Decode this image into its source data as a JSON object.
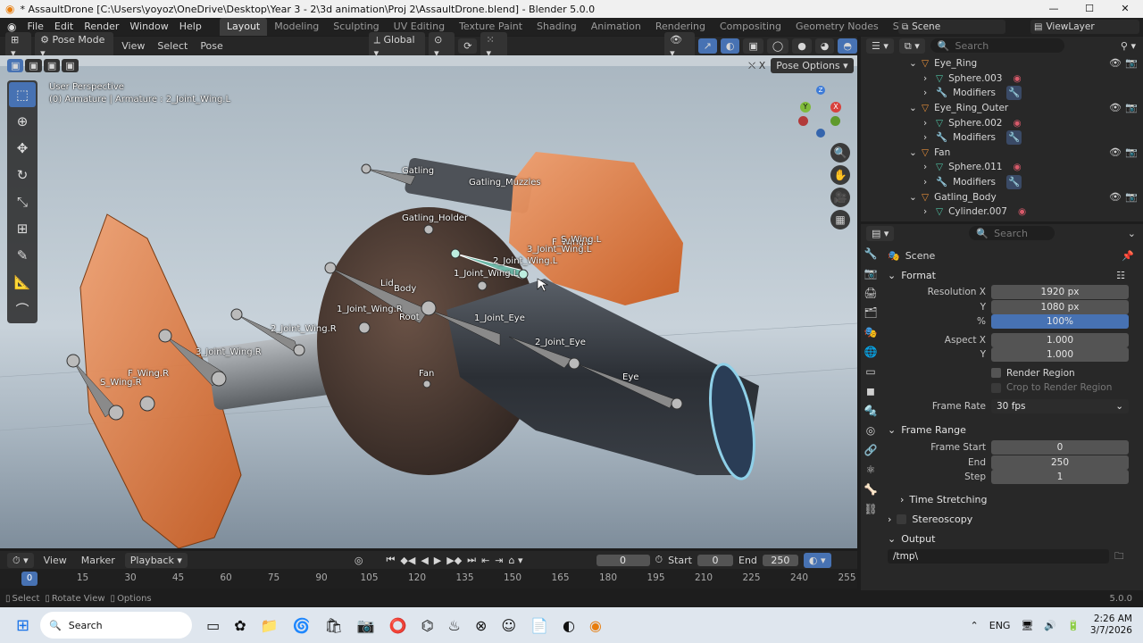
{
  "titlebar": {
    "title": "* AssaultDrone [C:\\Users\\yoyoz\\OneDrive\\Desktop\\Year 3 - 2\\3d animation\\Proj 2\\AssaultDrone.blend] - Blender 5.0.0",
    "minimize": "—",
    "maximize": "☐",
    "close": "✕"
  },
  "menu": {
    "items": [
      "File",
      "Edit",
      "Render",
      "Window",
      "Help"
    ],
    "workspaces": [
      "Layout",
      "Modeling",
      "Sculpting",
      "UV Editing",
      "Texture Paint",
      "Shading",
      "Animation",
      "Rendering",
      "Compositing",
      "Geometry Nodes",
      "Scripting"
    ],
    "add": "+",
    "scene": "Scene",
    "view_layer": "ViewLayer"
  },
  "viewport_header": {
    "mode": "Pose Mode",
    "view": "View",
    "select": "Select",
    "pose": "Pose",
    "orientation": "Global",
    "pose_options": "Pose Options"
  },
  "viewport": {
    "perspective": "User Perspective",
    "context": "(0) Armature | Armature : 2_Joint_Wing.L",
    "axis_x": "X",
    "axis_y": "Y",
    "axis_z": "Z",
    "bones": [
      "Gatling",
      "Gatling_Muzzles",
      "Gatling_Holder",
      "3_Joint_Wing.L",
      "F_Wing.L",
      "S_Wing.L",
      "2_Joint_Wing.L",
      "1_Joint_Wing.L",
      "Lid",
      "Body",
      "1_Joint_Wing.R",
      "Root",
      "2_Joint_Wing.R",
      "3_Joint_Wing.R",
      "F_Wing.R",
      "S_Wing.R",
      "1_Joint_Eye",
      "2_Joint_Eye",
      "Eye",
      "Fan"
    ]
  },
  "timeline": {
    "view": "View",
    "marker": "Marker",
    "playback": "Playback",
    "current_frame": "0",
    "start_label": "Start",
    "start": "0",
    "end_label": "End",
    "end": "250",
    "ticks": [
      "0",
      "15",
      "30",
      "45",
      "60",
      "75",
      "90",
      "105",
      "120",
      "135",
      "150",
      "165",
      "180",
      "195",
      "210",
      "225",
      "240",
      "255"
    ]
  },
  "statusbar": {
    "select": "Select",
    "rotate": "Rotate View",
    "options": "Options",
    "version": "5.0.0"
  },
  "outliner": {
    "search_placeholder": "Search",
    "rows": [
      {
        "name": "Eye_Ring",
        "type": "object",
        "depth": 0
      },
      {
        "name": "Sphere.003",
        "type": "mesh",
        "depth": 1
      },
      {
        "name": "Modifiers",
        "type": "modifier",
        "depth": 1
      },
      {
        "name": "Eye_Ring_Outer",
        "type": "object",
        "depth": 0
      },
      {
        "name": "Sphere.002",
        "type": "mesh",
        "depth": 1
      },
      {
        "name": "Modifiers",
        "type": "modifier",
        "depth": 1
      },
      {
        "name": "Fan",
        "type": "object",
        "depth": 0
      },
      {
        "name": "Sphere.011",
        "type": "mesh",
        "depth": 1
      },
      {
        "name": "Modifiers",
        "type": "modifier",
        "depth": 1
      },
      {
        "name": "Gatling_Body",
        "type": "object",
        "depth": 0
      },
      {
        "name": "Cylinder.007",
        "type": "mesh",
        "depth": 1
      }
    ]
  },
  "properties": {
    "search_placeholder": "Search",
    "context": "Scene",
    "format": {
      "title": "Format",
      "resolution_x_label": "Resolution X",
      "resolution_x": "1920 px",
      "y_label": "Y",
      "resolution_y": "1080 px",
      "percent_label": "%",
      "percent": "100%",
      "aspect_x_label": "Aspect X",
      "aspect_x": "1.000",
      "aspect_y_label": "Y",
      "aspect_y": "1.000",
      "render_region": "Render Region",
      "crop_region": "Crop to Render Region",
      "frame_rate_label": "Frame Rate",
      "frame_rate": "30 fps"
    },
    "frame_range": {
      "title": "Frame Range",
      "start_label": "Frame Start",
      "start": "0",
      "end_label": "End",
      "end": "250",
      "step_label": "Step",
      "step": "1"
    },
    "time_stretching": "Time Stretching",
    "stereoscopy": "Stereoscopy",
    "output": {
      "title": "Output",
      "path": "/tmp\\"
    }
  },
  "taskbar": {
    "search": "Search",
    "lang": "ENG",
    "time": "2:26 AM",
    "date": "3/7/2026"
  },
  "colors": {
    "accent": "#4772b3",
    "drone_orange": "#e0732d",
    "bone_grey": "#8a8a8a",
    "selected_bone": "#6fb8a8"
  }
}
